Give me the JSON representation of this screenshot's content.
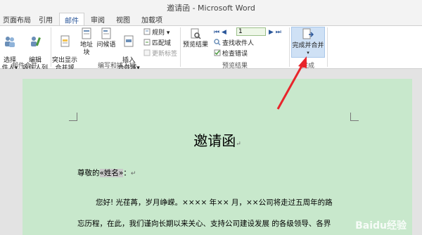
{
  "window": {
    "title": "邀请函 - Microsoft Word"
  },
  "tabs": [
    "页面布局",
    "引用",
    "邮件",
    "审阅",
    "视图",
    "加载项"
  ],
  "active_tab": "邮件",
  "ribbon": {
    "group1": {
      "btn_select_recipients": "选择\n件人▾",
      "btn_edit_recipients": "编辑\n收件人列表",
      "label": "邮件合并"
    },
    "group2": {
      "btn_highlight": "突出显示\n合并域",
      "btn_address_block": "地址块",
      "btn_greeting": "问候语",
      "btn_insert_field": "插入\n合并域▾",
      "rules": "规则 ▾",
      "match_fields": "匹配域",
      "update_labels": "更新标签",
      "label": "编写和插入域"
    },
    "group3": {
      "btn_preview": "预览结果",
      "record_number": "1",
      "find_recipient": "查找收件人",
      "check_errors": "检查错误",
      "label": "预览结果"
    },
    "group4": {
      "btn_finish": "完成并合并",
      "label": "完成"
    }
  },
  "document": {
    "title": "邀请函",
    "salutation_prefix": "尊敬的",
    "merge_field": "«姓名»",
    "salutation_suffix": "：",
    "line1": "您好! 光荏苒，岁月峥嵘。×××× 年×× 月，××公司将走过五周年的路",
    "line2": "忘历程，在此，我们谨向长期以来关心、支持公司建设发展 的各级领导、各界"
  },
  "watermark": "Baidu经验",
  "colors": {
    "accent": "#2b579a",
    "page_bg": "#c8e8cc",
    "arrow": "#e8252b"
  }
}
